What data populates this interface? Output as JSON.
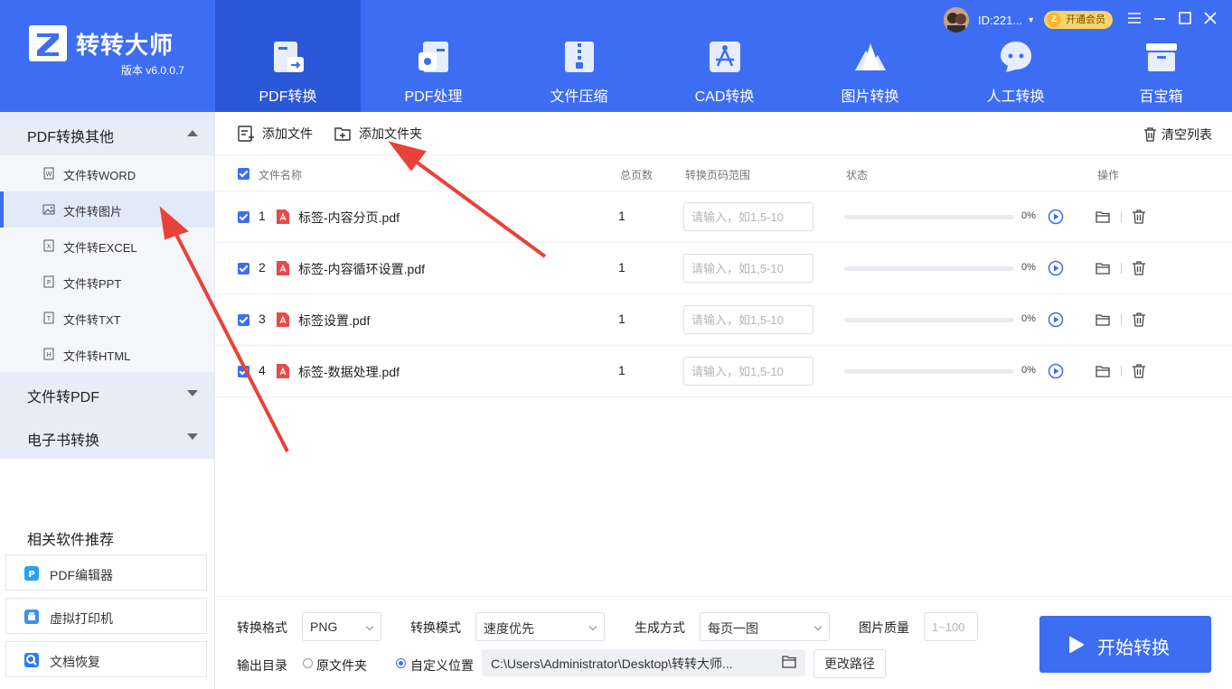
{
  "app": {
    "brand": "转转大师",
    "version": "版本 v6.0.0.7",
    "user_id": "ID:221...",
    "vip_label": "开通会员",
    "accent": "#3d6df2"
  },
  "nav": [
    {
      "label": "PDF转换",
      "icon": "pdf-convert-icon",
      "active": true
    },
    {
      "label": "PDF处理",
      "icon": "pdf-process-icon",
      "active": false
    },
    {
      "label": "文件压缩",
      "icon": "zip-icon",
      "active": false
    },
    {
      "label": "CAD转换",
      "icon": "cad-icon",
      "active": false
    },
    {
      "label": "图片转换",
      "icon": "image-icon",
      "active": false
    },
    {
      "label": "人工转换",
      "icon": "chat-icon",
      "active": false
    },
    {
      "label": "百宝箱",
      "icon": "toolbox-icon",
      "active": false
    }
  ],
  "sidebar": {
    "sections": [
      {
        "label": "PDF转换其他",
        "expanded": true
      },
      {
        "label": "文件转PDF",
        "expanded": false
      },
      {
        "label": "电子书转换",
        "expanded": false
      }
    ],
    "items": [
      {
        "label": "文件转WORD",
        "active": false
      },
      {
        "label": "文件转图片",
        "active": true
      },
      {
        "label": "文件转EXCEL",
        "active": false
      },
      {
        "label": "文件转PPT",
        "active": false
      },
      {
        "label": "文件转TXT",
        "active": false
      },
      {
        "label": "文件转HTML",
        "active": false
      }
    ],
    "recommend_title": "相关软件推荐",
    "recommend": [
      {
        "label": "PDF编辑器"
      },
      {
        "label": "虚拟打印机"
      },
      {
        "label": "文档恢复"
      }
    ]
  },
  "toolbar": {
    "add_file": "添加文件",
    "add_folder": "添加文件夹",
    "clear_list": "清空列表"
  },
  "table": {
    "headers": {
      "name": "文件名称",
      "pages": "总页数",
      "range": "转换页码范围",
      "status": "状态",
      "actions": "操作"
    },
    "range_placeholder": "请输入，如1,5-10",
    "rows": [
      {
        "index": "1",
        "name": "标签-内容分页.pdf",
        "pages": "1",
        "progress": 0,
        "progress_label": "0%"
      },
      {
        "index": "2",
        "name": "标签-内容循环设置.pdf",
        "pages": "1",
        "progress": 0,
        "progress_label": "0%"
      },
      {
        "index": "3",
        "name": "标签设置.pdf",
        "pages": "1",
        "progress": 0,
        "progress_label": "0%"
      },
      {
        "index": "4",
        "name": "标签-数据处理.pdf",
        "pages": "1",
        "progress": 0,
        "progress_label": "0%"
      }
    ]
  },
  "bottom": {
    "format_label": "转换格式",
    "format_value": "PNG",
    "mode_label": "转换模式",
    "mode_value": "速度优先",
    "gen_label": "生成方式",
    "gen_value": "每页一图",
    "quality_label": "图片质量",
    "quality_placeholder": "1~100",
    "output_label": "输出目录",
    "opt_original": "原文件夹",
    "opt_custom": "自定义位置",
    "output_path": "C:\\Users\\Administrator\\Desktop\\转转大师...",
    "change_path": "更改路径",
    "start": "开始转换"
  }
}
